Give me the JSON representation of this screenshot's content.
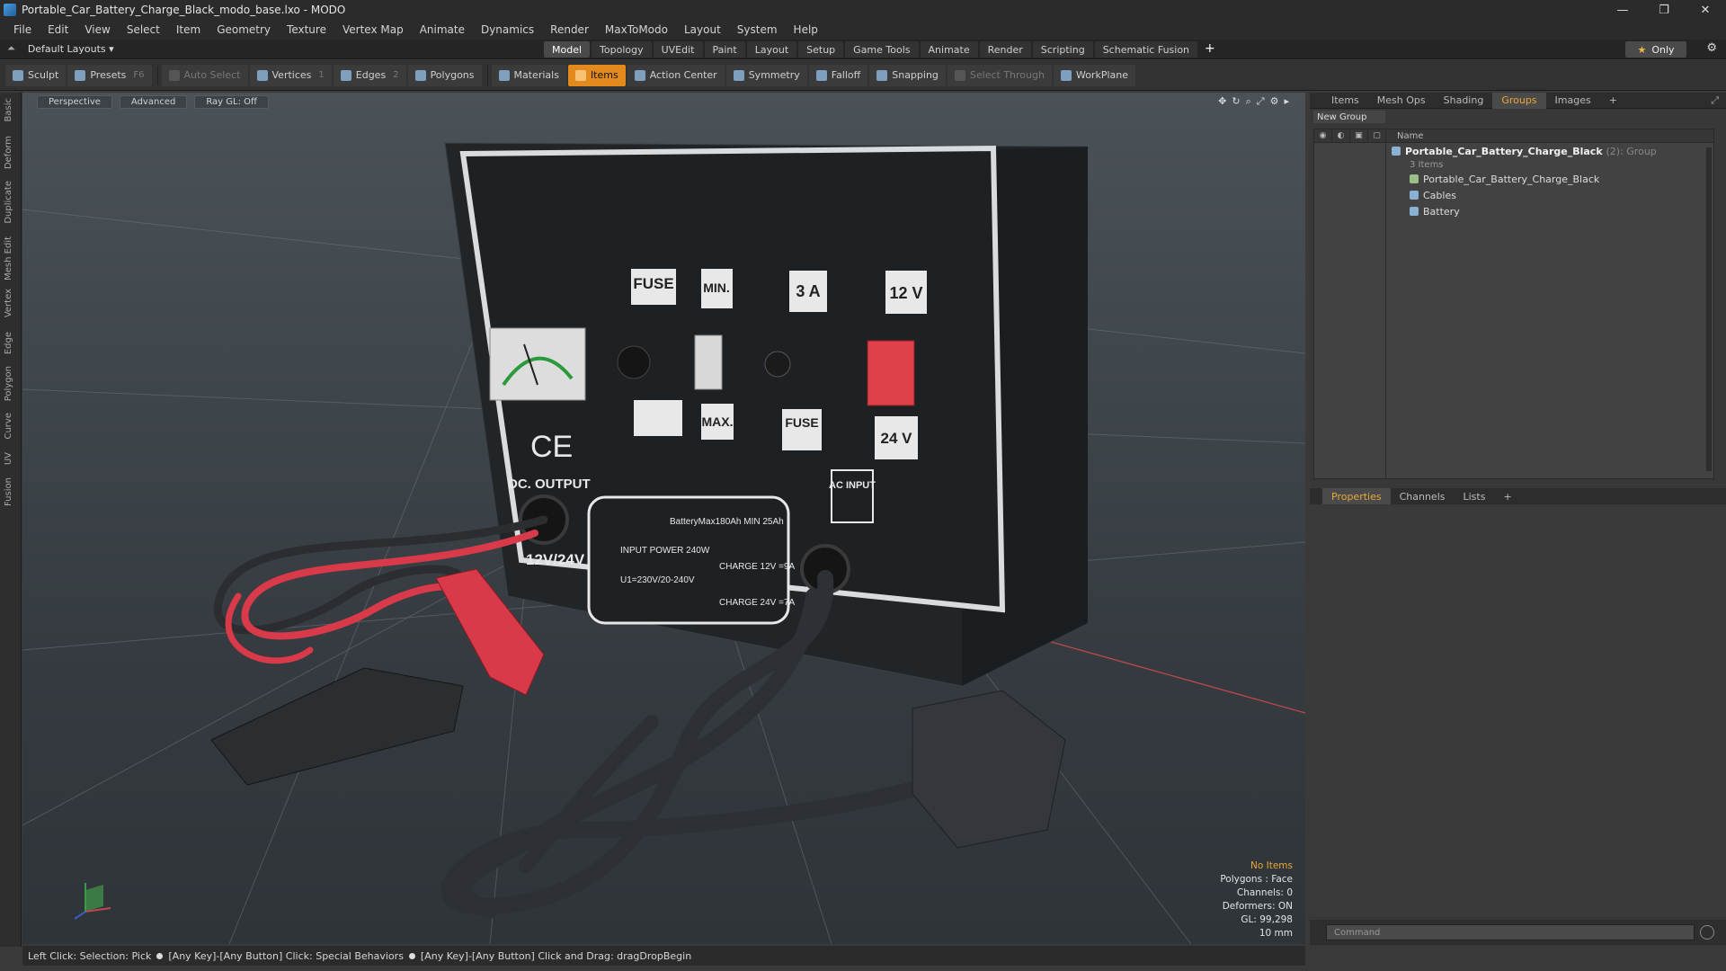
{
  "window": {
    "title": "Portable_Car_Battery_Charge_Black_modo_base.lxo - MODO",
    "minimize": "—",
    "maximize": "❐",
    "close": "✕"
  },
  "menu": [
    "File",
    "Edit",
    "View",
    "Select",
    "Item",
    "Geometry",
    "Texture",
    "Vertex Map",
    "Animate",
    "Dynamics",
    "Render",
    "MaxToModo",
    "Layout",
    "System",
    "Help"
  ],
  "layouts": {
    "label": "Default Layouts ▾"
  },
  "mode_tabs": [
    "Model",
    "Topology",
    "UVEdit",
    "Paint",
    "Layout",
    "Setup",
    "Game Tools",
    "Animate",
    "Render",
    "Scripting",
    "Schematic Fusion"
  ],
  "mode_tabs_active": "Model",
  "only_label": "Only",
  "toolbar": {
    "sculpt": "Sculpt",
    "presets": "Presets",
    "presets_key": "F6",
    "auto_select": "Auto Select",
    "vertices": "Vertices",
    "vertices_key": "1",
    "edges": "Edges",
    "edges_key": "2",
    "polygons": "Polygons",
    "materials": "Materials",
    "items": "Items",
    "action_center": "Action Center",
    "symmetry": "Symmetry",
    "falloff": "Falloff",
    "snapping": "Snapping",
    "select_through": "Select Through",
    "workplane": "WorkPlane"
  },
  "left_tabs": [
    "Basic",
    "Deform",
    "Duplicate",
    "Mesh Edit",
    "Vertex",
    "Edge",
    "Polygon",
    "Curve",
    "UV",
    "Fusion"
  ],
  "viewport": {
    "view": "Perspective",
    "shading": "Advanced",
    "raygl": "Ray GL: Off",
    "info": {
      "no_items": "No Items",
      "polygons": "Polygons : Face",
      "channels": "Channels: 0",
      "deformers": "Deformers: ON",
      "gl": "GL: 99,298",
      "scale": "10 mm"
    },
    "labels": {
      "fuse1": "FUSE",
      "min": "MIN.",
      "three_a": "3 A",
      "twelve_v": "12 V",
      "max": "MAX.",
      "fuse2": "FUSE",
      "twentyfour_v": "24 V",
      "ce": "CE",
      "dc_output": "DC. OUTPUT",
      "ac_input": "AC INPUT",
      "spec1": "BatteryMax180Ah MIN 25Ah",
      "spec2": "INPUT POWER 240W",
      "spec3": "CHARGE 12V =9A",
      "spec4": "U1=230V/20-240V",
      "spec5": "CHARGE 24V =7A",
      "volt": "12V/24V"
    }
  },
  "status_bar": {
    "part1": "Left Click: Selection: Pick",
    "part2": "[Any Key]-[Any Button] Click: Special Behaviors",
    "part3": "[Any Key]-[Any Button] Click and Drag: dragDropBegin"
  },
  "right_panel": {
    "tabs": [
      "Items",
      "Mesh Ops",
      "Shading",
      "Groups",
      "Images"
    ],
    "active_tab": "Groups",
    "new_group": "New Group",
    "name_header": "Name",
    "group": {
      "name": "Portable_Car_Battery_Charge_Black",
      "count": "(2)",
      "type": ": Group",
      "items_count": "3 Items"
    },
    "children": [
      "Portable_Car_Battery_Charge_Black",
      "Cables",
      "Battery"
    ],
    "prop_tabs": [
      "Properties",
      "Channels",
      "Lists"
    ],
    "prop_active": "Properties",
    "command_placeholder": "Command"
  },
  "colors": {
    "accent": "#e28a1e",
    "active_tab_text": "#e8a838"
  }
}
